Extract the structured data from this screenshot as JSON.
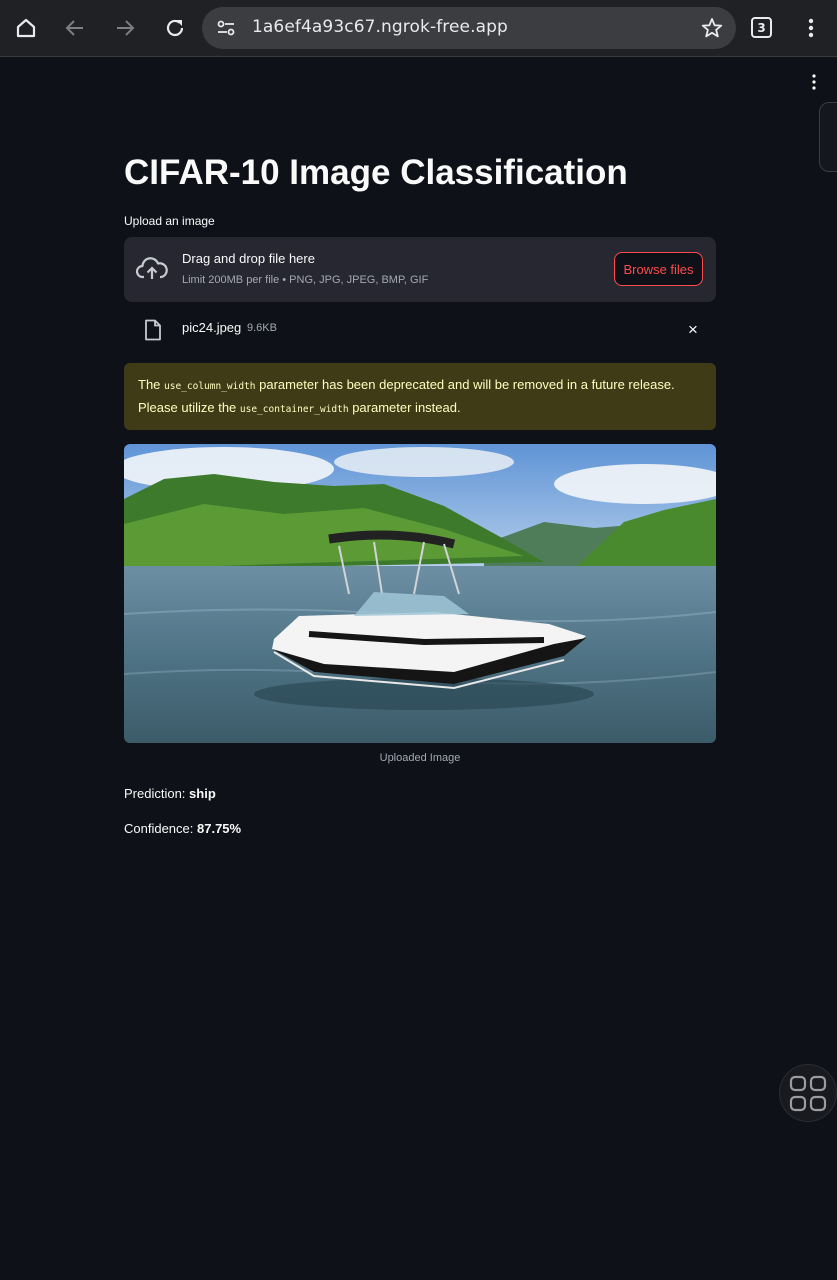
{
  "browser": {
    "url": "1a6ef4a93c67.ngrok-free.app",
    "tab_count": "3"
  },
  "app": {
    "title": "CIFAR-10 Image Classification",
    "uploader": {
      "label": "Upload an image",
      "drop_text": "Drag and drop file here",
      "limit_text": "Limit 200MB per file • PNG, JPG, JPEG, BMP, GIF",
      "browse_label": "Browse files"
    },
    "file": {
      "name": "pic24.jpeg",
      "size": "9.6KB",
      "remove_icon": "×"
    },
    "warning": {
      "part1": "The ",
      "code1": "use_column_width",
      "part2": " parameter has been deprecated and will be removed in a future release. Please utilize the ",
      "code2": "use_container_width",
      "part3": " parameter instead."
    },
    "image_caption": "Uploaded Image",
    "prediction": {
      "label": "Prediction: ",
      "value": "ship"
    },
    "confidence": {
      "label": "Confidence: ",
      "value": "87.75%"
    }
  },
  "colors": {
    "background": "#0e1117",
    "accent": "#ff4b4b",
    "warning_bg": "#3e3b16",
    "warning_text": "#ffffc2"
  },
  "icons": [
    "home-icon",
    "back-arrow-icon",
    "forward-arrow-icon",
    "reload-icon",
    "site-settings-icon",
    "star-icon",
    "tabs-icon",
    "overflow-menu-icon",
    "cloud-upload-icon",
    "file-icon",
    "close-icon",
    "grid-icon"
  ]
}
